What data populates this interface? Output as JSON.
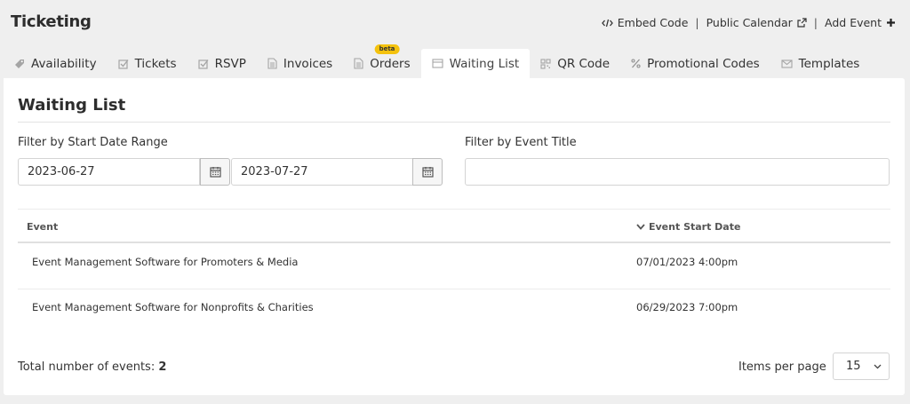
{
  "app": {
    "title": "Ticketing"
  },
  "top_links": {
    "embed_code": "Embed Code",
    "public_calendar": "Public Calendar",
    "add_event": "Add Event"
  },
  "tabs": [
    {
      "label": "Availability",
      "icon": "tag-icon"
    },
    {
      "label": "Tickets",
      "icon": "checkbox-icon"
    },
    {
      "label": "RSVP",
      "icon": "checkbox-icon"
    },
    {
      "label": "Invoices",
      "icon": "document-icon"
    },
    {
      "label": "Orders",
      "icon": "document-icon",
      "badge": "beta"
    },
    {
      "label": "Waiting List",
      "icon": "list-icon",
      "active": true
    },
    {
      "label": "QR Code",
      "icon": "qr-icon"
    },
    {
      "label": "Promotional Codes",
      "icon": "percent-icon"
    },
    {
      "label": "Templates",
      "icon": "envelope-icon"
    }
  ],
  "main": {
    "title": "Waiting List",
    "filter_date_label": "Filter by Start Date Range",
    "date_from": "2023-06-27",
    "date_to": "2023-07-27",
    "filter_title_label": "Filter by Event Title",
    "filter_title_value": ""
  },
  "table": {
    "columns": [
      "Event",
      "Event Start Date"
    ],
    "sorted_column": "Event Start Date",
    "rows": [
      {
        "event": "Event Management Software for Promoters & Media",
        "start": "07/01/2023 4:00pm"
      },
      {
        "event": "Event Management Software for Nonprofits & Charities",
        "start": "06/29/2023 7:00pm"
      }
    ]
  },
  "footer": {
    "total_label": "Total number of events:",
    "total_value": "2",
    "items_per_page_label": "Items per page",
    "items_per_page_value": "15"
  },
  "colors": {
    "background": "#efefef",
    "panel": "#ffffff",
    "beta_badge": "#f4c20d",
    "text": "#333333"
  }
}
